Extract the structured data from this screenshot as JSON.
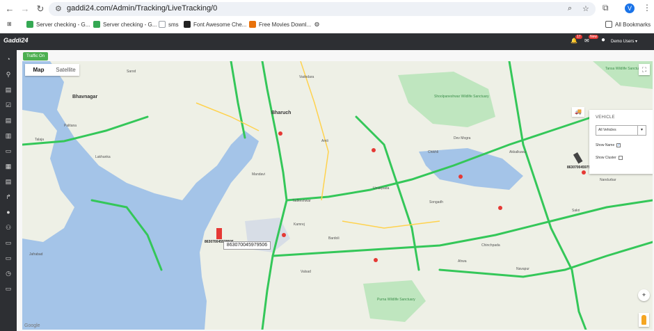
{
  "browser": {
    "url": "gaddi24.com/Admin/Tracking/LiveTracking/0",
    "profile_initial": "V",
    "bookmarks": [
      {
        "label": "Server checking - G...",
        "color": "#34a853"
      },
      {
        "label": "Server checking - G...",
        "color": "#34a853"
      },
      {
        "label": "sms",
        "color": "#9aa0a6"
      },
      {
        "label": "Font Awesome Che...",
        "color": "#222222"
      },
      {
        "label": "Free Movies Downl...",
        "color": "#e8710a"
      }
    ],
    "all_bookmarks": "All Bookmarks"
  },
  "app": {
    "logo": "Gaddi24",
    "notification_badge": "17",
    "message_badge": "New",
    "user": "Demo Users",
    "traffic_button": "Traffic On"
  },
  "map": {
    "type_map": "Map",
    "type_satellite": "Satellite",
    "imei_label": "863070045979506",
    "marker_label_small": "863070045979506",
    "marker_label_east": "863070045979506",
    "google": "Google",
    "places": [
      {
        "name": "Bhavnagar",
        "cls": "big"
      },
      {
        "name": "Bharuch",
        "cls": "big"
      },
      {
        "name": "Shoolpaneshwar Wildlife Sanctuary",
        "cls": "park"
      },
      {
        "name": "Purna Wildlife Sanctuary",
        "cls": "park"
      },
      {
        "name": "Tansa Wildlife Sanctuary",
        "cls": "park"
      },
      {
        "name": "Talaja",
        "cls": ""
      },
      {
        "name": "Palitana",
        "cls": ""
      },
      {
        "name": "Lakhanka",
        "cls": ""
      },
      {
        "name": "Vadodara",
        "cls": ""
      },
      {
        "name": "Amli",
        "cls": ""
      },
      {
        "name": "Umarpada",
        "cls": ""
      },
      {
        "name": "Nandurbar",
        "cls": ""
      },
      {
        "name": "Dev Mogra",
        "cls": ""
      },
      {
        "name": "Chikhli",
        "cls": ""
      },
      {
        "name": "Akkalkuwa",
        "cls": ""
      },
      {
        "name": "Tadkeshwar",
        "cls": ""
      },
      {
        "name": "Kamrej",
        "cls": ""
      },
      {
        "name": "Bardoli",
        "cls": ""
      },
      {
        "name": "Jafrabad",
        "cls": ""
      },
      {
        "name": "Sarod",
        "cls": ""
      },
      {
        "name": "Chinchpada",
        "cls": ""
      },
      {
        "name": "Navapur",
        "cls": ""
      },
      {
        "name": "Songadh",
        "cls": ""
      },
      {
        "name": "Sakri",
        "cls": ""
      },
      {
        "name": "Ahwa",
        "cls": ""
      },
      {
        "name": "Valsad",
        "cls": ""
      },
      {
        "name": "Mandavi",
        "cls": ""
      }
    ]
  },
  "vehicle_panel": {
    "title": "VEHICLE",
    "select_value": "All Vehicles",
    "show_name": "Show Name",
    "show_cluster": "Show Cluster"
  },
  "colors": {
    "header_bg": "#2d2f33",
    "traffic_green": "#4caf50",
    "water": "#a4c4e8",
    "park": "#bfe6bf",
    "road_green": "#34c759"
  }
}
